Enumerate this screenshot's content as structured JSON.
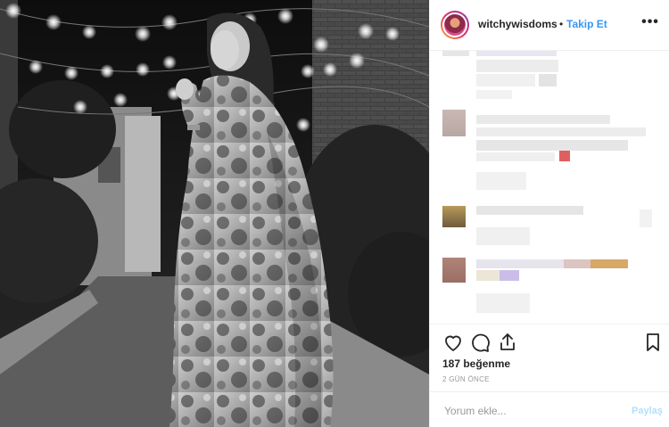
{
  "header": {
    "username": "witchywisdoms",
    "separator": "•",
    "follow_label": "Takip Et",
    "more_label": "•••"
  },
  "actions": {
    "like_icon": "heart-icon",
    "comment_icon": "comment-icon",
    "share_icon": "share-icon",
    "save_icon": "bookmark-icon"
  },
  "likes": "187 beğenme",
  "timestamp": "2 GÜN ÖNCE",
  "composer": {
    "placeholder": "Yorum ekle...",
    "share_label": "Paylaş"
  },
  "colors": {
    "accent": "#3897f0",
    "share_disabled": "#b2dffc",
    "border": "#efefef"
  }
}
